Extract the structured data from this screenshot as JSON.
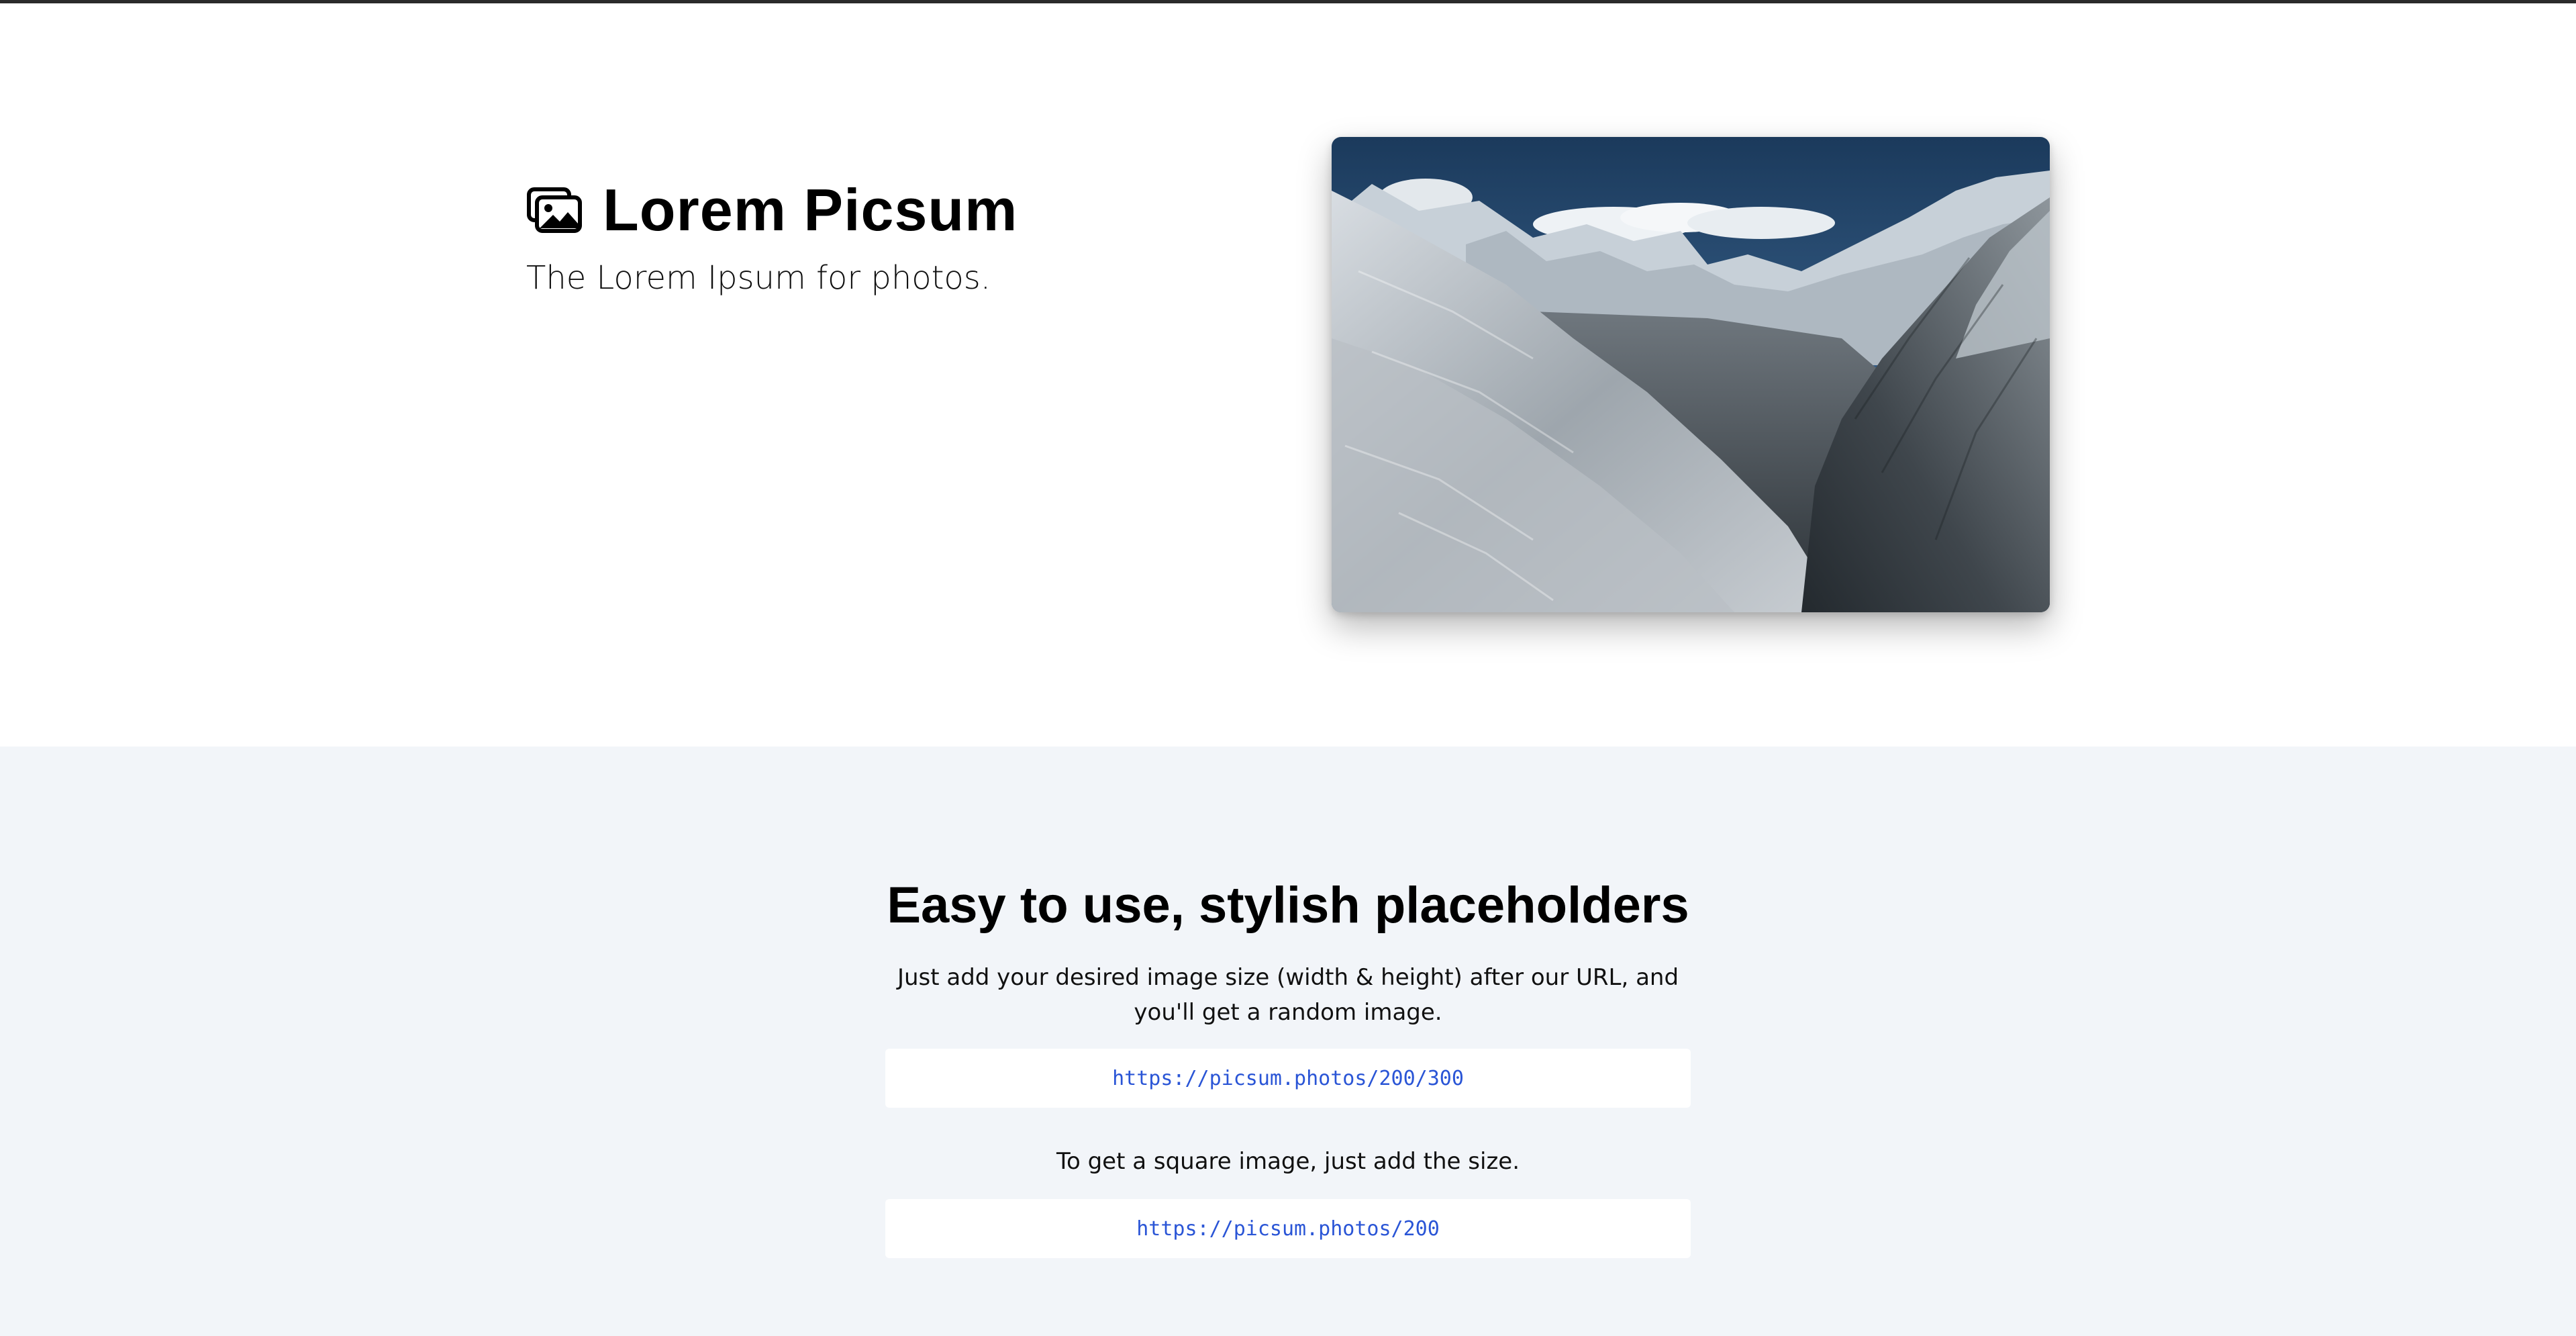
{
  "hero": {
    "title": "Lorem Picsum",
    "tagline": "The Lorem Ipsum for photos.",
    "logo_icon": "photos-icon",
    "photo": "snowy mountain valley photograph"
  },
  "usage": {
    "heading": "Easy to use, stylish placeholders",
    "intro": "Just add your desired image size (width & height) after our URL, and you'll get a random image.",
    "example_url": "https://picsum.photos/200/300",
    "square_text": "To get a square image, just add the size.",
    "square_url": "https://picsum.photos/200"
  },
  "colors": {
    "section_background": "#f2f5f9",
    "code_link": "#2a55d6",
    "top_rule": "#2b2b2b"
  }
}
